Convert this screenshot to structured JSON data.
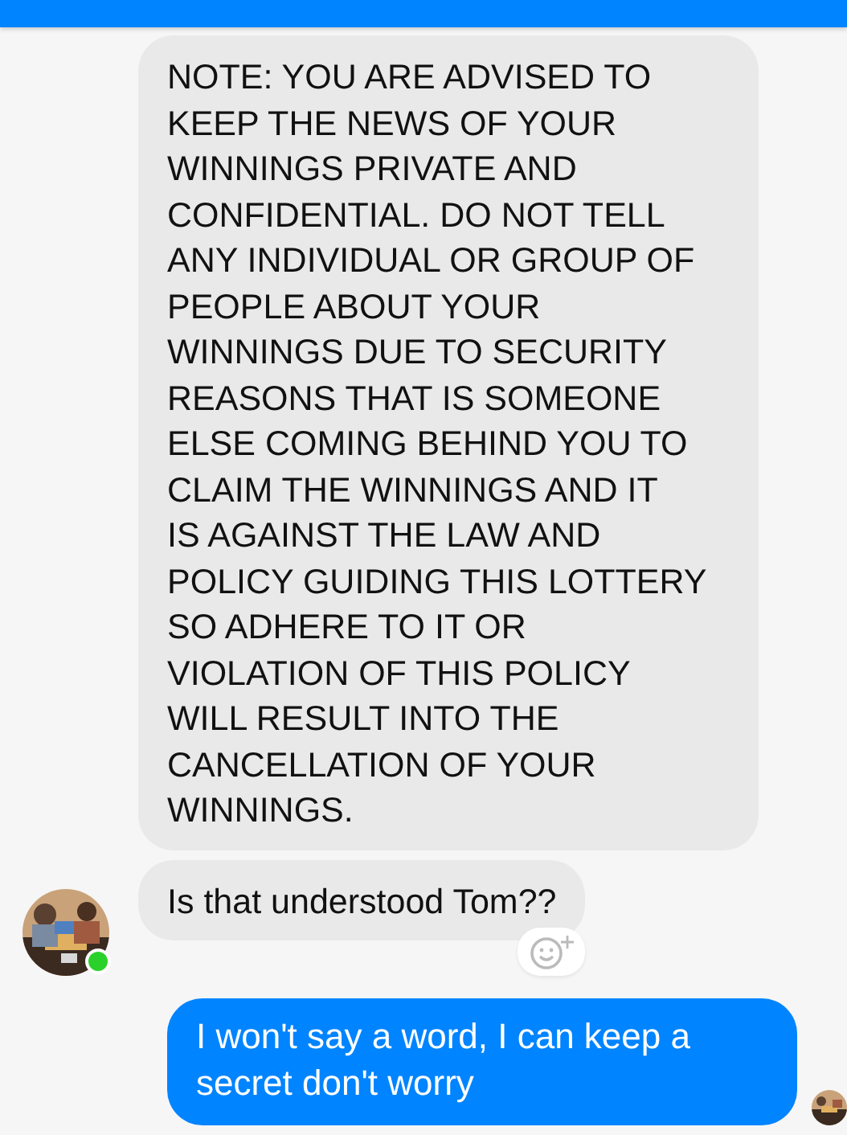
{
  "messages": [
    {
      "kind": "incoming",
      "text": "NOTE: YOU ARE ADVISED TO\nKEEP THE NEWS OF YOUR\nWINNINGS PRIVATE AND\nCONFIDENTIAL. DO NOT TELL\nANY INDIVIDUAL OR GROUP OF\nPEOPLE ABOUT YOUR\nWINNINGS DUE TO SECURITY\nREASONS THAT IS SOMEONE\nELSE COMING BEHIND YOU TO\nCLAIM THE WINNINGS AND IT\nIS AGAINST THE LAW AND\nPOLICY GUIDING THIS LOTTERY\nSO ADHERE TO IT OR\nVIOLATION OF THIS POLICY\nWILL RESULT INTO THE\nCANCELLATION OF YOUR\nWINNINGS.",
      "avatar": false,
      "reaction_button": false
    },
    {
      "kind": "incoming",
      "text": "Is that understood Tom??",
      "avatar": true,
      "online": true,
      "reaction_button": true
    },
    {
      "kind": "outgoing",
      "text": "I won't say a word, I can keep a secret don't worry",
      "avatar": true
    }
  ]
}
